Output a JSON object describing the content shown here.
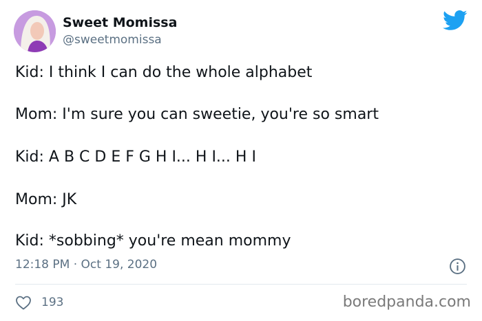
{
  "author": {
    "display_name": "Sweet Momissa",
    "handle": "@sweetmomissa"
  },
  "tweet": {
    "lines": [
      "Kid: I think I can do the whole alphabet",
      "Mom: I'm sure you can sweetie, you're so smart",
      "Kid: A B C D E F G H I... H I... H I",
      "Mom: JK",
      "Kid: *sobbing* you're mean mommy"
    ],
    "timestamp": "12:18 PM · Oct 19, 2020",
    "likes": "193"
  },
  "icons": {
    "brand": "twitter-bird-icon",
    "info": "info-icon",
    "like": "heart-icon"
  },
  "watermark": "boredpanda.com",
  "colors": {
    "twitter_blue": "#1da1f2",
    "text": "#0f1419",
    "secondary": "#5b7083",
    "divider": "#e1e8ed"
  }
}
